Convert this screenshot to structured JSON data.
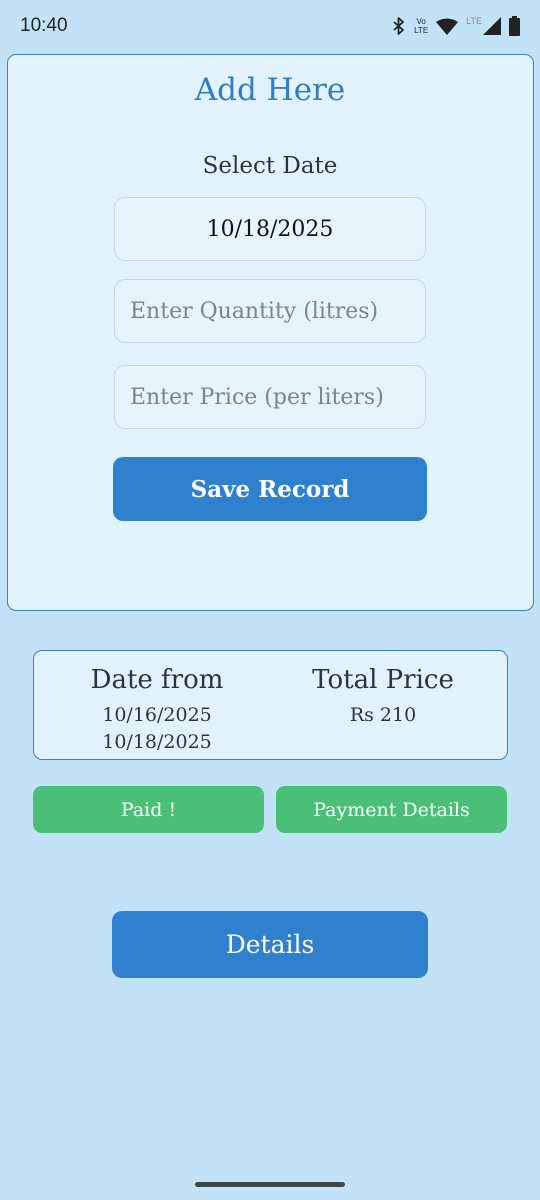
{
  "status_bar": {
    "time": "10:40",
    "volte_line1": "Vo",
    "volte_line2": "LTE",
    "lte_label": "LTE",
    "icons": [
      "bluetooth-icon",
      "volte-icon",
      "wifi-icon",
      "signal-icon",
      "battery-icon"
    ]
  },
  "add_form": {
    "title": "Add Here",
    "select_date_label": "Select Date",
    "date_value": "10/18/2025",
    "quantity_placeholder": "Enter Quantity (litres)",
    "price_placeholder": "Enter Price (per liters)",
    "save_label": "Save Record"
  },
  "summary": {
    "date_header": "Date from",
    "date_from": "10/16/2025",
    "date_to": "10/18/2025",
    "price_header": "Total Price",
    "total_price": "Rs 210"
  },
  "actions": {
    "paid_label": "Paid !",
    "payment_details_label": "Payment Details",
    "details_label": "Details"
  },
  "colors": {
    "background": "#c2e2f8",
    "card": "#e2f3fd",
    "primary": "#3080d0",
    "success": "#4bbf78"
  }
}
